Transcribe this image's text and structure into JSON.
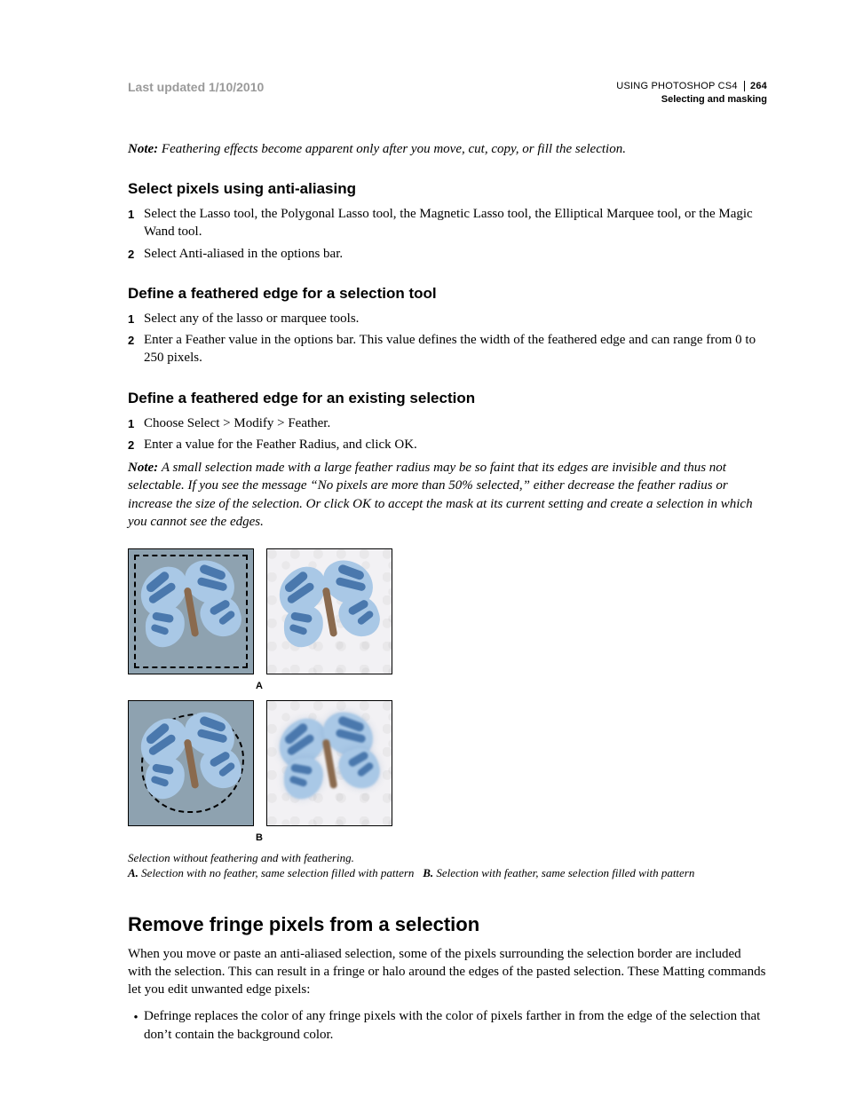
{
  "header": {
    "last_updated": "Last updated 1/10/2010",
    "doc_title": "USING PHOTOSHOP CS4",
    "section": "Selecting and masking",
    "page_number": "264"
  },
  "note1": {
    "label": "Note:",
    "text": "Feathering effects become apparent only after you move, cut, copy, or fill the selection."
  },
  "sec_aa": {
    "heading": "Select pixels using anti-aliasing",
    "steps": [
      "Select the Lasso tool, the Polygonal Lasso tool, the Magnetic Lasso tool, the Elliptical Marquee tool, or the Magic Wand tool.",
      "Select Anti-aliased in the options bar."
    ]
  },
  "sec_feather_tool": {
    "heading": "Define a feathered edge for a selection tool",
    "steps": [
      "Select any of the lasso or marquee tools.",
      "Enter a Feather value in the options bar. This value defines the width of the feathered edge and can range from 0 to 250 pixels."
    ]
  },
  "sec_feather_existing": {
    "heading": "Define a feathered edge for an existing selection",
    "steps": [
      "Choose Select > Modify > Feather.",
      "Enter a value for the Feather Radius, and click OK."
    ]
  },
  "note2": {
    "label": "Note:",
    "text": "A small selection made with a large feather radius may be so faint that its edges are invisible and thus not selectable. If you see the message “No pixels are more than 50% selected,” either decrease the feather radius or increase the size of the selection. Or click OK to accept the mask at its current setting and create a selection in which you cannot see the edges."
  },
  "figure": {
    "letter_a": "A",
    "letter_b": "B",
    "caption_lead": "Selection without feathering and with feathering.",
    "caption_a_key": "A.",
    "caption_a": "Selection with no feather, same selection filled with pattern",
    "caption_b_key": "B.",
    "caption_b": "Selection with feather, same selection filled with pattern"
  },
  "sec_fringe": {
    "heading": "Remove fringe pixels from a selection",
    "intro": "When you move or paste an anti-aliased selection, some of the pixels surrounding the selection border are included with the selection. This can result in a fringe or halo around the edges of the pasted selection. These Matting commands let you edit unwanted edge pixels:",
    "bullets": [
      "Defringe replaces the color of any fringe pixels with the color of pixels farther in from the edge of the selection that don’t contain the background color."
    ]
  },
  "nums": {
    "1": "1",
    "2": "2"
  },
  "dot": "•"
}
